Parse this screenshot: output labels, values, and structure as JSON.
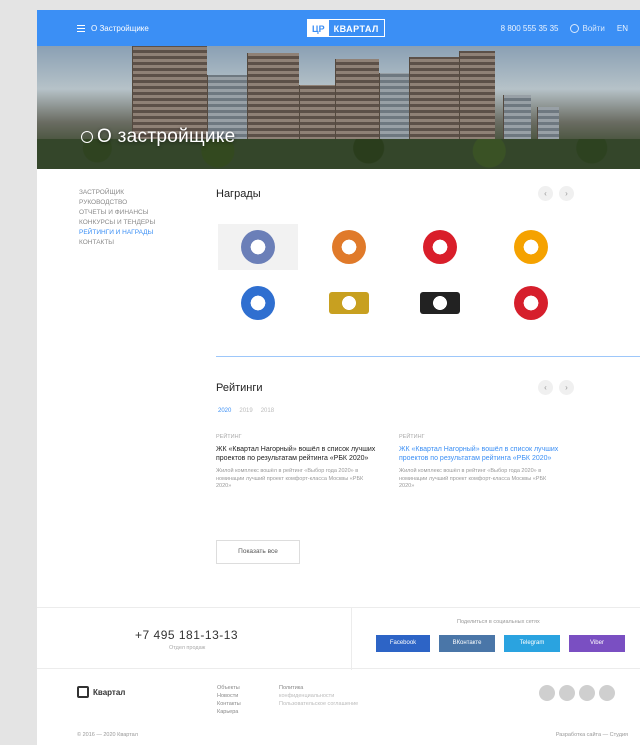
{
  "header": {
    "menu_label": "О Застройщике",
    "logo_left": "ЦР",
    "logo_right": "КВАРТАЛ",
    "phone_link": "8 800 555 35 35",
    "login_label": "Войти",
    "lang_label": "EN"
  },
  "hero": {
    "title": "О застройщике"
  },
  "sidebar": {
    "items": [
      {
        "label": "ЗАСТРОЙЩИК"
      },
      {
        "label": "РУКОВОДСТВО"
      },
      {
        "label": "ОТЧЕТЫ И ФИНАНСЫ"
      },
      {
        "label": "КОНКУРСЫ И ТЕНДЕРЫ"
      },
      {
        "label": "РЕЙТИНГИ И НАГРАДЫ"
      },
      {
        "label": "КОНТАКТЫ"
      }
    ],
    "active_index": 4
  },
  "awards": {
    "title": "Награды",
    "prev": "‹",
    "next": "›",
    "items": [
      {
        "name": "award-1",
        "color": "#6b7fb8"
      },
      {
        "name": "award-2",
        "color": "#e07a2a"
      },
      {
        "name": "award-3",
        "color": "#d91e2a"
      },
      {
        "name": "award-4",
        "color": "#f5a200"
      },
      {
        "name": "award-5",
        "color": "#2f6fd0"
      },
      {
        "name": "award-6",
        "color": "#c8a020"
      },
      {
        "name": "award-7",
        "color": "#222222"
      },
      {
        "name": "award-8",
        "color": "#d61f2c"
      }
    ]
  },
  "ratings": {
    "title": "Рейтинги",
    "prev": "‹",
    "next": "›",
    "tabs": [
      "2020",
      "2019",
      "2018"
    ],
    "active_tab": 0,
    "items": [
      {
        "category": "РЕЙТИНГ",
        "title": "ЖК «Квартал Нагорный» вошёл в список лучших проектов по результатам рейтинга «РБК 2020»",
        "desc": "Жилой комплекс вошёл в рейтинг «Выбор года 2020» в номинации лучший проект комфорт-класса Москвы «РБК 2020»"
      },
      {
        "category": "РЕЙТИНГ",
        "title": "ЖК «Квартал Нагорный» вошёл в список лучших проектов по результатам рейтинга «РБК 2020»",
        "desc": "Жилой комплекс вошёл в рейтинг «Выбор года 2020» в номинации лучший проект комфорт-класса Москвы «РБК 2020»"
      }
    ],
    "show_all": "Показать все"
  },
  "contacts": {
    "phone": "+7 495 181-13-13",
    "phone_sub": "Отдел продаж",
    "share_label": "Поделиться в социальных сетях",
    "socials": [
      {
        "label": "Facebook",
        "color": "#2d64c6"
      },
      {
        "label": "ВКонтакте",
        "color": "#4a76a8"
      },
      {
        "label": "Telegram",
        "color": "#2aa3e0"
      },
      {
        "label": "Viber",
        "color": "#7a4fc2"
      }
    ]
  },
  "footer": {
    "logo_text": "Квартал",
    "col1": [
      "Объекты",
      "Новости",
      "Контакты",
      "Карьера"
    ],
    "col2": [
      "Политика",
      "конфиденциальности",
      "Пользовательское соглашение"
    ],
    "copyright": "© 2016 — 2020 Квартал",
    "made": "Разработка сайта — Студия"
  }
}
